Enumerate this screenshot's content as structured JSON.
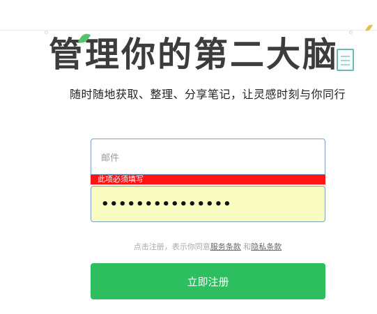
{
  "hero": {
    "title": "管理你的第二大脑",
    "subtitle": "随时随地获取、整理、分享笔记，让灵感时刻与你同行"
  },
  "form": {
    "email_placeholder": "邮件",
    "email_error": "此项必须填写",
    "password_value": "•••••••••••••••"
  },
  "terms": {
    "prefix": "点击注册，表示你同意",
    "service_link": "服务条款",
    "and": " 和",
    "privacy_link": "隐私条款"
  },
  "signup_button_label": "立即注册",
  "colors": {
    "accent_green": "#2dbe60",
    "error_red": "#ff1414",
    "autofill_yellow": "#f9fcc0"
  }
}
